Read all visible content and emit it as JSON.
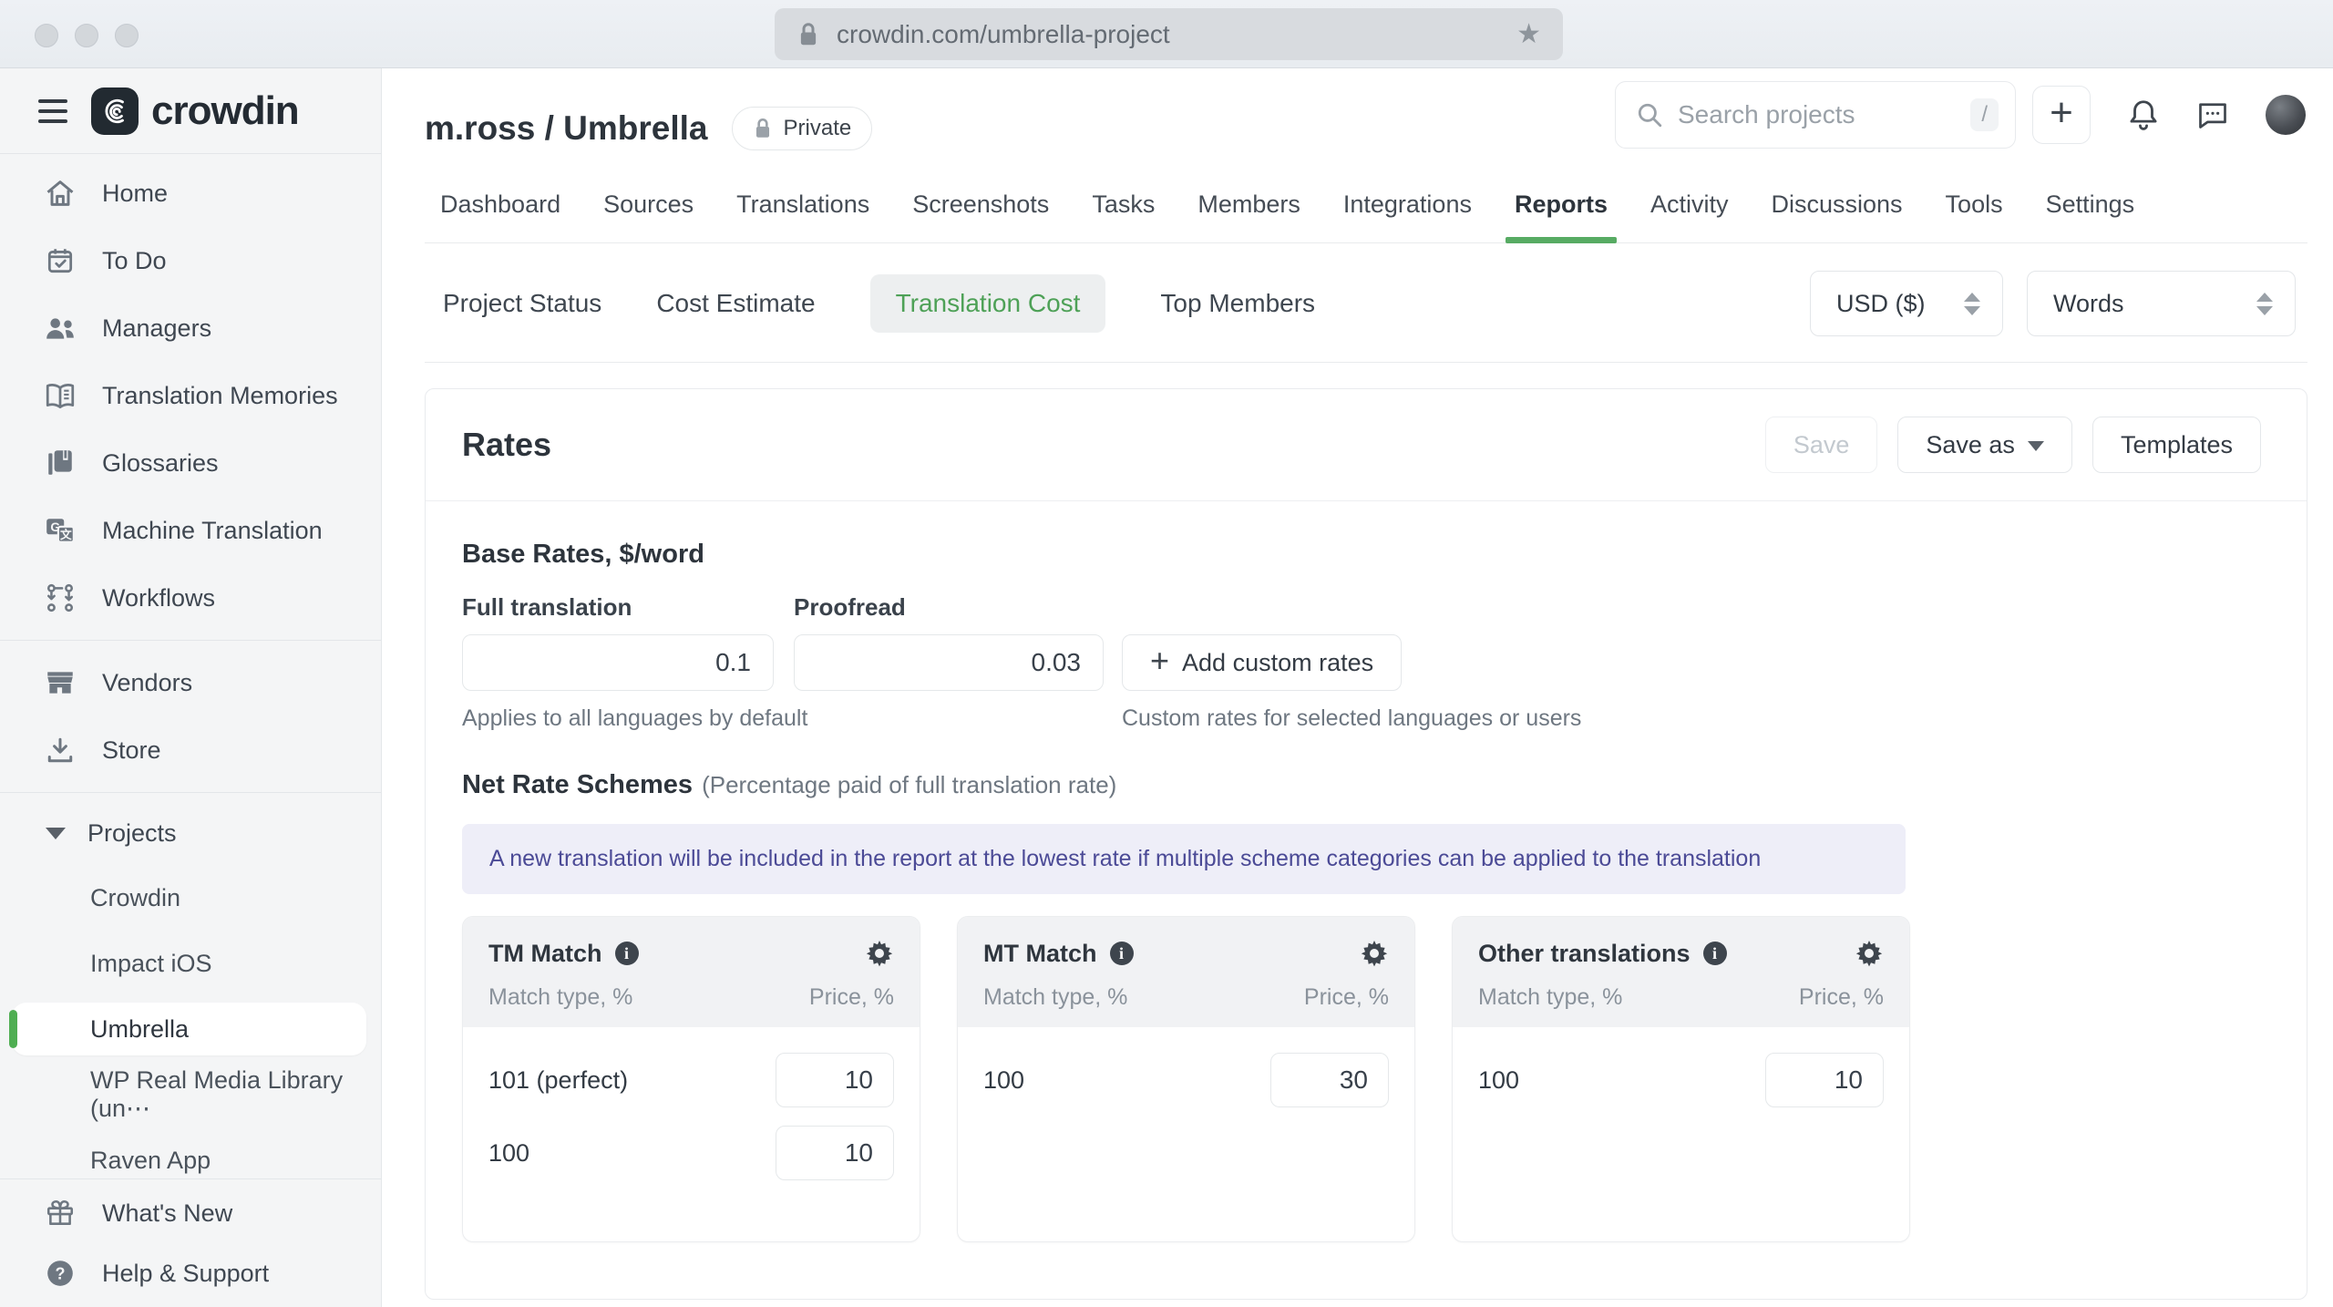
{
  "browser": {
    "url": "crowdin.com/umbrella-project"
  },
  "sidebar": {
    "brand": "crowdin",
    "items": [
      {
        "label": "Home"
      },
      {
        "label": "To Do"
      },
      {
        "label": "Managers"
      },
      {
        "label": "Translation Memories"
      },
      {
        "label": "Glossaries"
      },
      {
        "label": "Machine Translation"
      },
      {
        "label": "Workflows"
      },
      {
        "label": "Vendors"
      },
      {
        "label": "Store"
      }
    ],
    "projects_label": "Projects",
    "projects": [
      {
        "label": "Crowdin"
      },
      {
        "label": "Impact iOS"
      },
      {
        "label": "Umbrella"
      },
      {
        "label": "WP Real Media Library (un⋯"
      },
      {
        "label": "Raven App"
      }
    ],
    "footer": [
      {
        "label": "What's New"
      },
      {
        "label": "Help & Support"
      }
    ]
  },
  "header": {
    "title": "m.ross / Umbrella",
    "badge": "Private",
    "search_placeholder": "Search projects",
    "shortcut": "/"
  },
  "tabs": [
    {
      "label": "Dashboard"
    },
    {
      "label": "Sources"
    },
    {
      "label": "Translations"
    },
    {
      "label": "Screenshots"
    },
    {
      "label": "Tasks"
    },
    {
      "label": "Members"
    },
    {
      "label": "Integrations"
    },
    {
      "label": "Reports"
    },
    {
      "label": "Activity"
    },
    {
      "label": "Discussions"
    },
    {
      "label": "Tools"
    },
    {
      "label": "Settings"
    }
  ],
  "subtabs": [
    {
      "label": "Project Status"
    },
    {
      "label": "Cost Estimate"
    },
    {
      "label": "Translation Cost"
    },
    {
      "label": "Top Members"
    }
  ],
  "selectors": {
    "currency": "USD ($)",
    "unit": "Words"
  },
  "rates": {
    "title": "Rates",
    "save": "Save",
    "save_as": "Save as",
    "templates": "Templates"
  },
  "base_rates": {
    "title": "Base Rates, $/word",
    "full_label": "Full translation",
    "full_value": "0.1",
    "proofread_label": "Proofread",
    "proofread_value": "0.03",
    "add_custom": "Add custom rates",
    "full_note": "Applies to all languages by default",
    "custom_note": "Custom rates for selected languages or users"
  },
  "net_rate": {
    "title": "Net Rate Schemes",
    "subtitle": "(Percentage paid of full translation rate)",
    "banner": "A new translation will be included in the report at the lowest rate if multiple scheme categories can be applied to the translation",
    "columns": {
      "match": "Match type, %",
      "price": "Price, %"
    },
    "schemes": [
      {
        "title": "TM Match",
        "rows": [
          {
            "match": "101 (perfect)",
            "price": "10"
          },
          {
            "match": "100",
            "price": "10"
          }
        ]
      },
      {
        "title": "MT Match",
        "rows": [
          {
            "match": "100",
            "price": "30"
          }
        ]
      },
      {
        "title": "Other translations",
        "rows": [
          {
            "match": "100",
            "price": "10"
          }
        ]
      }
    ]
  },
  "colors": {
    "accent_green": "#57ab63",
    "selected_bar_green": "#4fae52",
    "banner_bg": "#eeeef8",
    "banner_text": "#4b4a96"
  }
}
